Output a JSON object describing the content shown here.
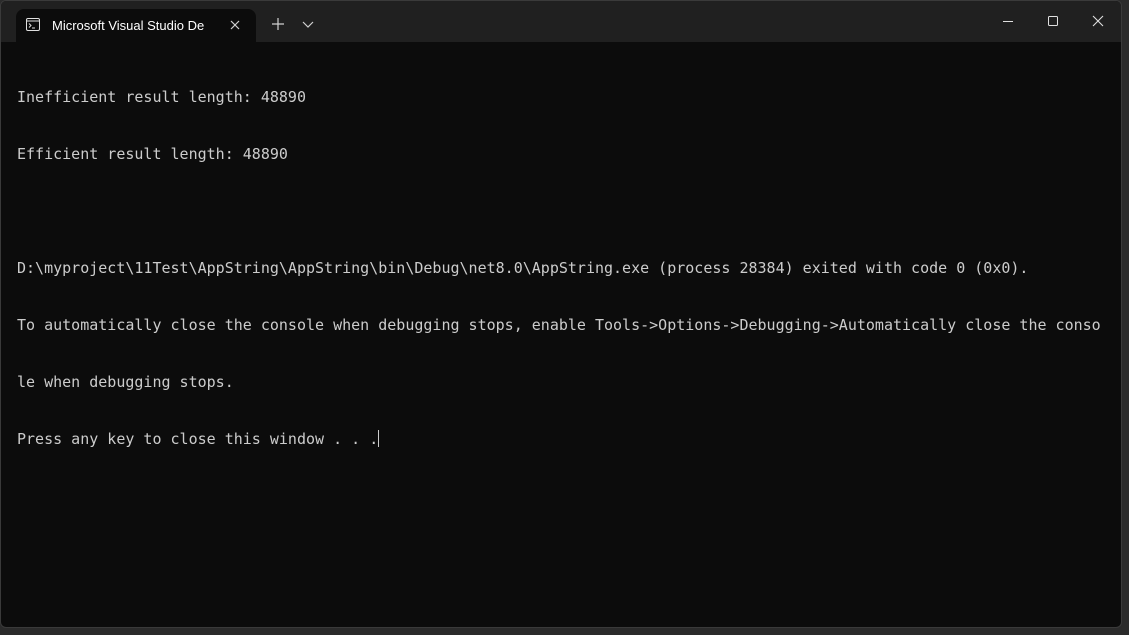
{
  "window": {
    "tab_title": "Microsoft Visual Studio Debug Console",
    "tab_icon": "console-icon",
    "new_tab_icon": "plus-icon",
    "dropdown_icon": "chevron-down-icon",
    "minimize_icon": "minimize-icon",
    "maximize_icon": "maximize-icon",
    "close_icon": "close-icon"
  },
  "console": {
    "lines": [
      "Inefficient result length: 48890",
      "Efficient result length: 48890",
      "",
      "D:\\myproject\\11Test\\AppString\\AppString\\bin\\Debug\\net8.0\\AppString.exe (process 28384) exited with code 0 (0x0).",
      "To automatically close the console when debugging stops, enable Tools->Options->Debugging->Automatically close the conso",
      "le when debugging stops.",
      "Press any key to close this window . . ."
    ]
  },
  "colors": {
    "background": "#0c0c0c",
    "titlebar": "#202020",
    "text": "#cccccc"
  }
}
